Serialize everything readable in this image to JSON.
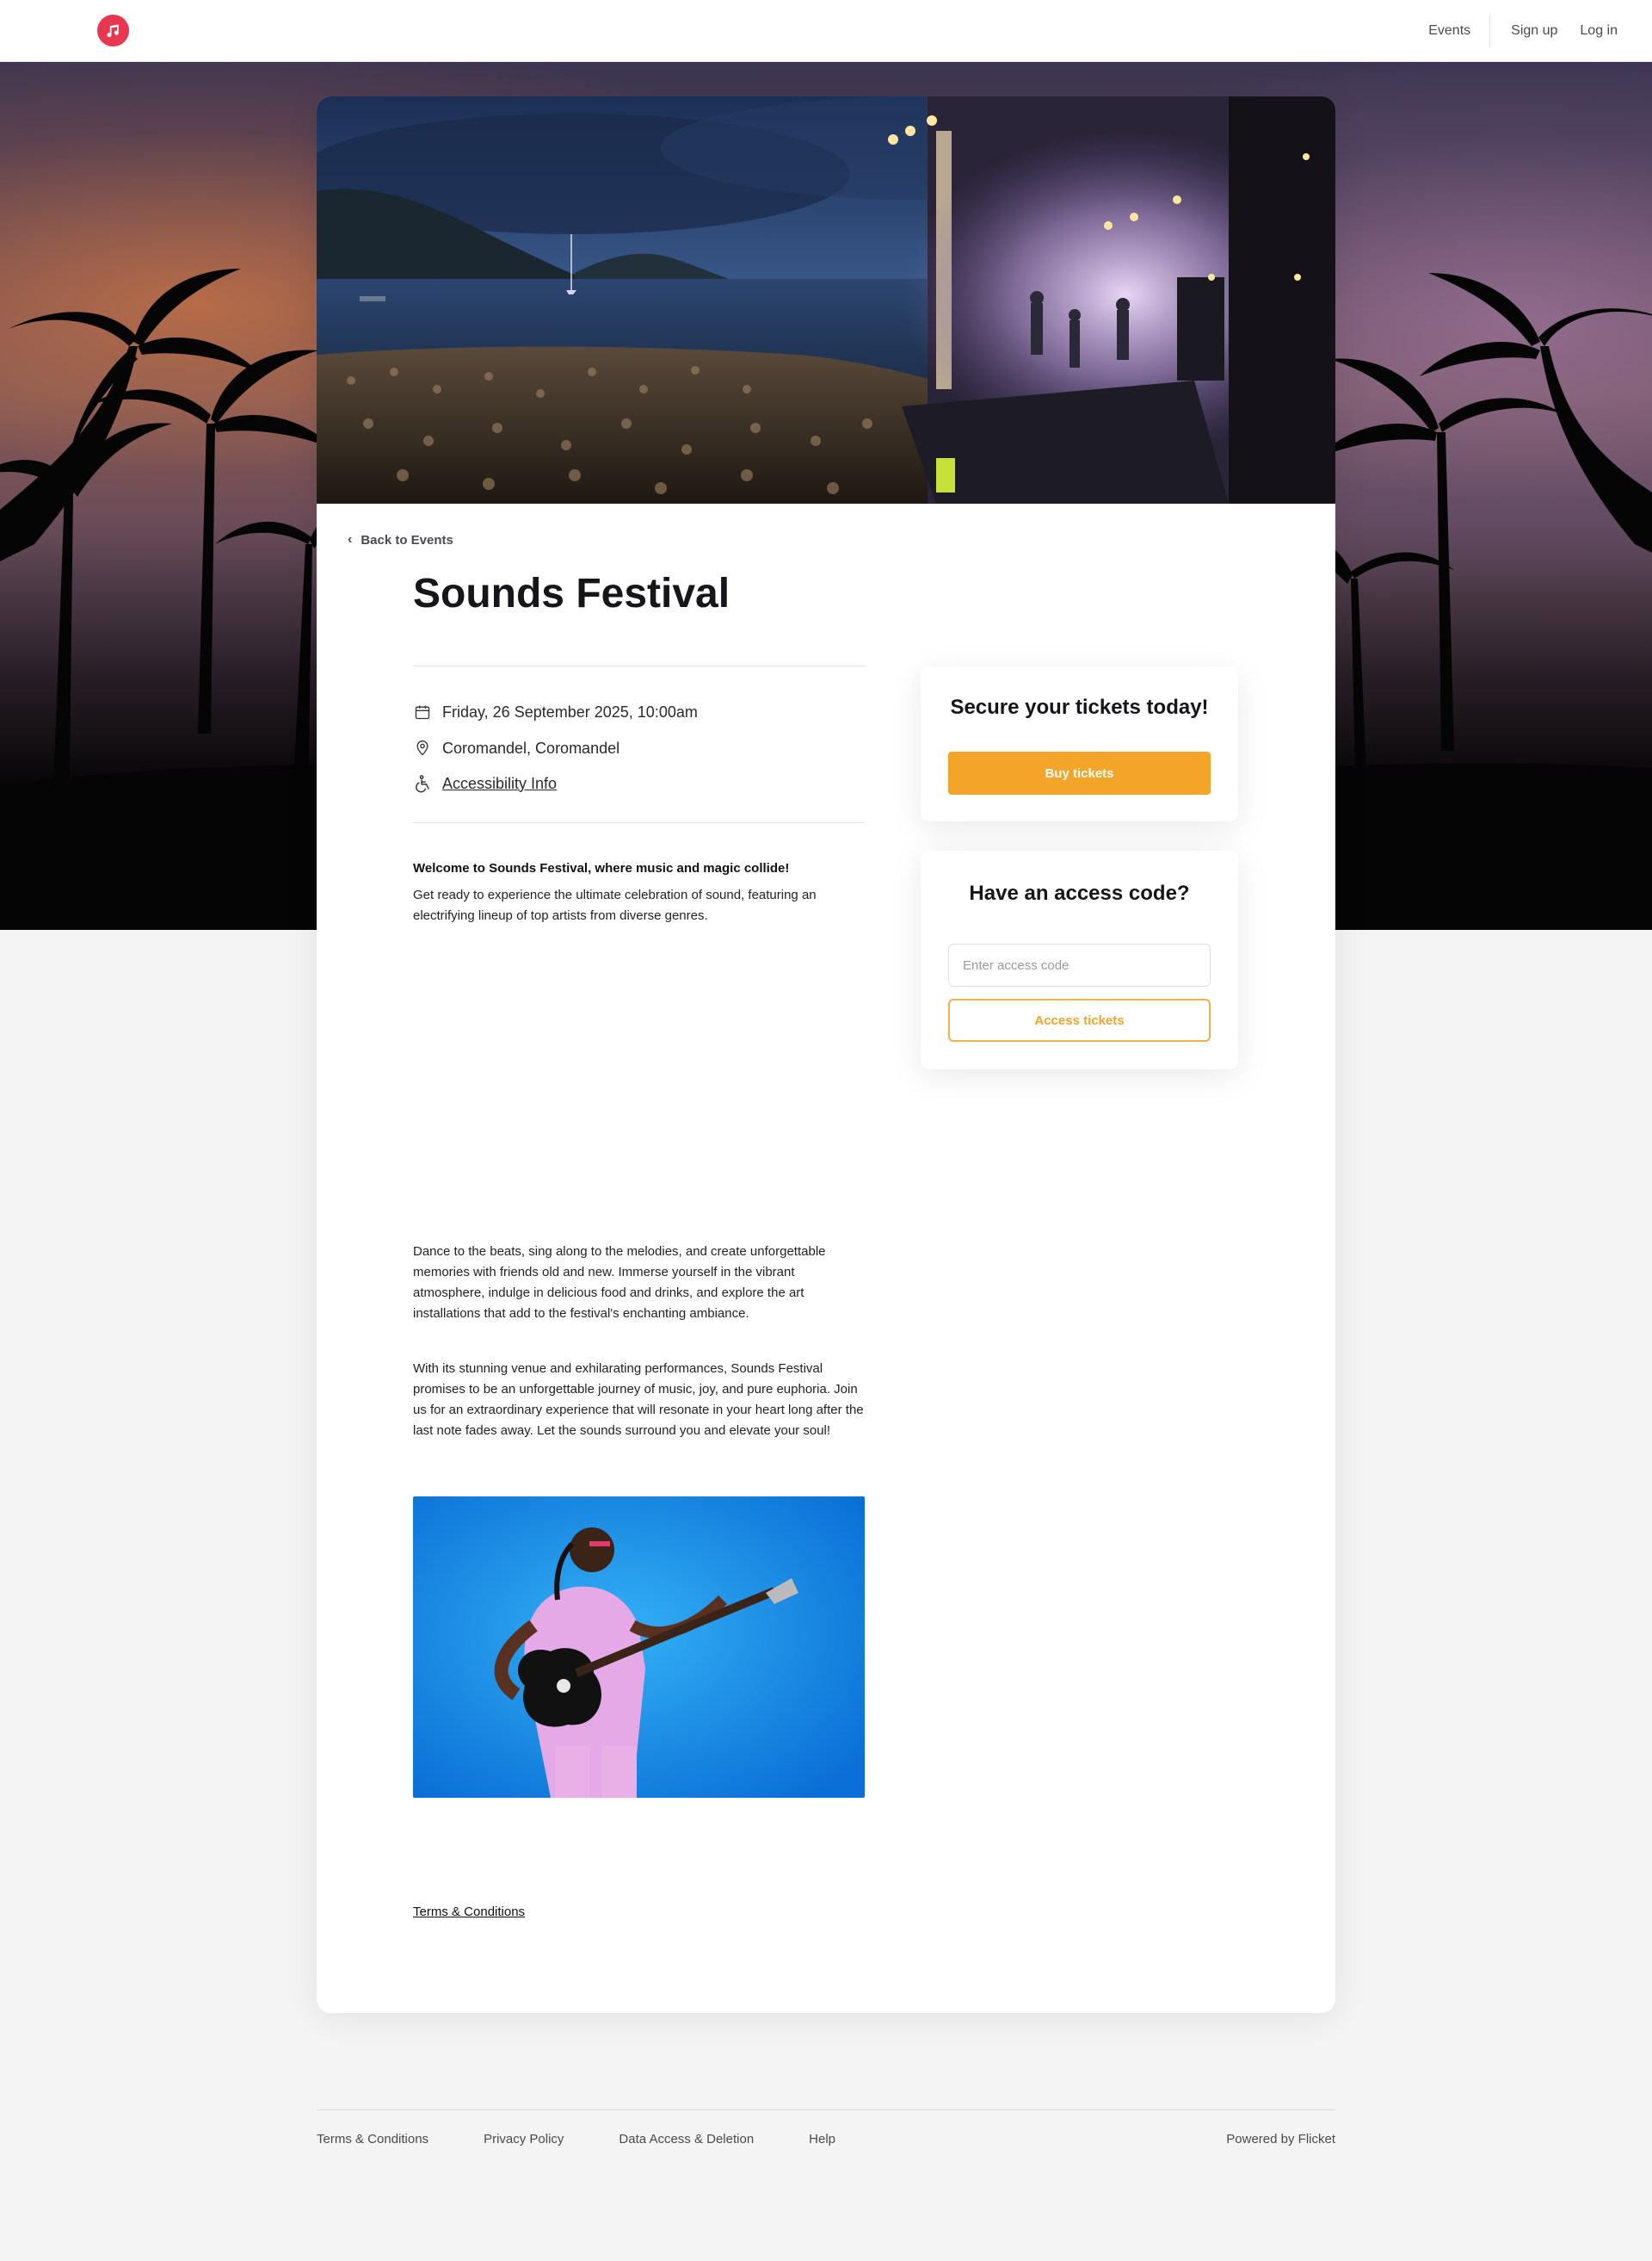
{
  "header": {
    "nav": {
      "events": "Events",
      "signup": "Sign up",
      "login": "Log in"
    }
  },
  "event": {
    "back_label": "Back to Events",
    "title": "Sounds Festival",
    "datetime": "Friday, 26 September 2025, 10:00am",
    "location": "Coromandel, Coromandel",
    "accessibility": "Accessibility Info",
    "description": {
      "intro_bold": "Welcome to Sounds Festival, where music and magic collide!",
      "intro": "Get ready to experience the ultimate celebration of sound, featuring an electrifying lineup of top artists from diverse genres.",
      "para2": "Dance to the beats, sing along to the melodies, and create unforgettable memories with friends old and new. Immerse yourself in the vibrant atmosphere, indulge in delicious food and drinks, and explore the art installations that add to the festival's enchanting ambiance.",
      "para3": "With its stunning venue and exhilarating performances, Sounds Festival promises to be an unforgettable journey of music, joy, and pure euphoria. Join us for an extraordinary experience that will resonate in your heart long after the last note fades away. Let the sounds surround you and elevate your soul!"
    },
    "terms": "Terms & Conditions"
  },
  "tickets_panel": {
    "heading": "Secure your tickets today!",
    "buy_label": "Buy tickets"
  },
  "access_panel": {
    "heading": "Have an access code?",
    "input_placeholder": "Enter access code",
    "input_value": "",
    "button_label": "Access tickets"
  },
  "footer": {
    "links": [
      "Terms & Conditions",
      "Privacy Policy",
      "Data Access & Deletion",
      "Help"
    ],
    "powered_by": "Powered by Flicket"
  },
  "colors": {
    "brand_logo": "#e8384f",
    "accent": "#f4a428",
    "background": "#f4f4f4"
  },
  "icons": {
    "logo": "music-note-icon",
    "back": "chevron-left-icon",
    "date": "calendar-icon",
    "location": "map-pin-icon",
    "accessibility": "wheelchair-icon"
  }
}
